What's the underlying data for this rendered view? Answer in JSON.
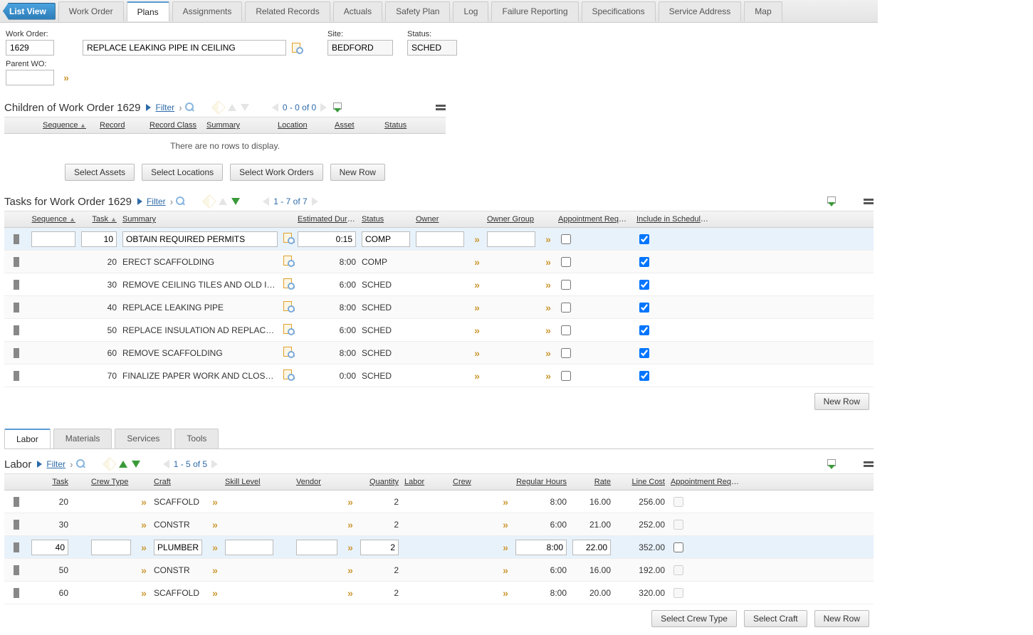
{
  "listview_label": "List View",
  "tabs": [
    "Work Order",
    "Plans",
    "Assignments",
    "Related Records",
    "Actuals",
    "Safety Plan",
    "Log",
    "Failure Reporting",
    "Specifications",
    "Service Address",
    "Map"
  ],
  "active_tab": 1,
  "header": {
    "wo_label": "Work Order:",
    "wo_num": "1629",
    "wo_desc": "REPLACE LEAKING PIPE IN CEILING",
    "site_label": "Site:",
    "site": "BEDFORD",
    "status_label": "Status:",
    "status": "SCHED",
    "parent_label": "Parent WO:",
    "parent": ""
  },
  "children_section": {
    "title": "Children of Work Order 1629",
    "filter": "Filter",
    "pager": "0 - 0 of 0",
    "cols": [
      "Sequence",
      "Record",
      "Record Class",
      "Summary",
      "Location",
      "Asset",
      "Status"
    ],
    "empty": "There are no rows to display.",
    "buttons": [
      "Select Assets",
      "Select Locations",
      "Select Work Orders",
      "New Row"
    ]
  },
  "tasks_section": {
    "title": "Tasks for Work Order 1629",
    "filter": "Filter",
    "pager": "1 - 7 of 7",
    "cols": {
      "sequence": "Sequence",
      "task": "Task",
      "summary": "Summary",
      "est": "Estimated Duration",
      "status": "Status",
      "owner": "Owner",
      "ownergrp": "Owner Group",
      "appt": "Appointment Required?",
      "incl": "Include in Schedule?"
    },
    "rows": [
      {
        "seq": "",
        "task": "10",
        "summary": "OBTAIN REQUIRED PERMITS",
        "est": "0:15",
        "status": "COMP",
        "owner": "",
        "ownergrp": "",
        "appt": false,
        "incl": true,
        "sel": true
      },
      {
        "seq": "",
        "task": "20",
        "summary": "ERECT SCAFFOLDING",
        "est": "8:00",
        "status": "COMP",
        "owner": "",
        "ownergrp": "",
        "appt": false,
        "incl": true,
        "sel": false
      },
      {
        "seq": "",
        "task": "30",
        "summary": "REMOVE CEILING TILES AND OLD INSULATION",
        "est": "6:00",
        "status": "SCHED",
        "owner": "",
        "ownergrp": "",
        "appt": false,
        "incl": true,
        "sel": false
      },
      {
        "seq": "",
        "task": "40",
        "summary": "REPLACE LEAKING PIPE",
        "est": "8:00",
        "status": "SCHED",
        "owner": "",
        "ownergrp": "",
        "appt": false,
        "incl": true,
        "sel": false
      },
      {
        "seq": "",
        "task": "50",
        "summary": "REPLACE INSULATION AD REPLACE CEILING TILES",
        "est": "6:00",
        "status": "SCHED",
        "owner": "",
        "ownergrp": "",
        "appt": false,
        "incl": true,
        "sel": false
      },
      {
        "seq": "",
        "task": "60",
        "summary": "REMOVE SCAFFOLDING",
        "est": "8:00",
        "status": "SCHED",
        "owner": "",
        "ownergrp": "",
        "appt": false,
        "incl": true,
        "sel": false
      },
      {
        "seq": "",
        "task": "70",
        "summary": "FINALIZE PAPER WORK AND CLOSE WORK ORDER",
        "est": "0:00",
        "status": "SCHED",
        "owner": "",
        "ownergrp": "",
        "appt": false,
        "incl": true,
        "sel": false
      }
    ],
    "new_row": "New Row"
  },
  "sub_tabs": [
    "Labor",
    "Materials",
    "Services",
    "Tools"
  ],
  "active_sub_tab": 0,
  "labor_section": {
    "title": "Labor",
    "filter": "Filter",
    "pager": "1 - 5 of 5",
    "cols": {
      "task": "Task",
      "crewtype": "Crew Type",
      "craft": "Craft",
      "skill": "Skill Level",
      "vendor": "Vendor",
      "qty": "Quantity",
      "labor": "Labor",
      "crew": "Crew",
      "reghrs": "Regular Hours",
      "rate": "Rate",
      "linecost": "Line Cost",
      "appt": "Appointment Required?"
    },
    "rows": [
      {
        "task": "20",
        "crewtype": "",
        "craft": "SCAFFOLD",
        "skill": "",
        "vendor": "",
        "qty": "2",
        "labor": "",
        "crew": "",
        "reghrs": "8:00",
        "rate": "16.00",
        "linecost": "256.00",
        "appt": false,
        "sel": false
      },
      {
        "task": "30",
        "crewtype": "",
        "craft": "CONSTR",
        "skill": "",
        "vendor": "",
        "qty": "2",
        "labor": "",
        "crew": "",
        "reghrs": "6:00",
        "rate": "21.00",
        "linecost": "252.00",
        "appt": false,
        "sel": false
      },
      {
        "task": "40",
        "crewtype": "",
        "craft": "PLUMBER",
        "skill": "",
        "vendor": "",
        "qty": "2",
        "labor": "",
        "crew": "",
        "reghrs": "8:00",
        "rate": "22.00",
        "linecost": "352.00",
        "appt": false,
        "sel": true
      },
      {
        "task": "50",
        "crewtype": "",
        "craft": "CONSTR",
        "skill": "",
        "vendor": "",
        "qty": "2",
        "labor": "",
        "crew": "",
        "reghrs": "6:00",
        "rate": "16.00",
        "linecost": "192.00",
        "appt": false,
        "sel": false
      },
      {
        "task": "60",
        "crewtype": "",
        "craft": "SCAFFOLD",
        "skill": "",
        "vendor": "",
        "qty": "2",
        "labor": "",
        "crew": "",
        "reghrs": "8:00",
        "rate": "20.00",
        "linecost": "320.00",
        "appt": false,
        "sel": false
      }
    ],
    "buttons": [
      "Select Crew Type",
      "Select Craft",
      "New Row"
    ]
  }
}
